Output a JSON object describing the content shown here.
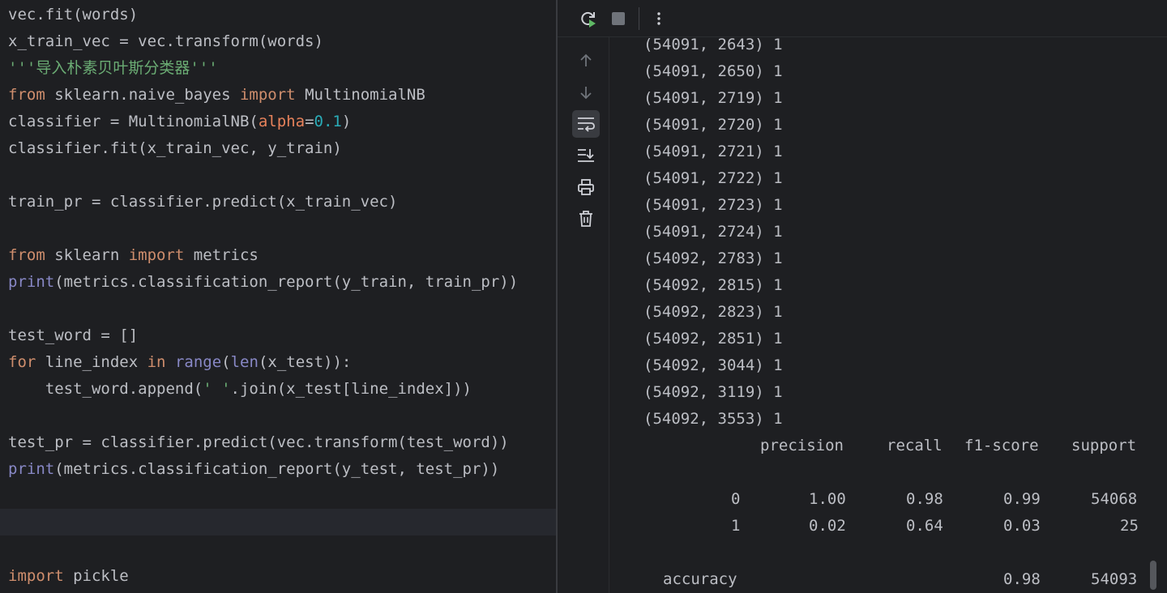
{
  "editor": {
    "lines": [
      [
        {
          "t": "vec.fit(words)",
          "c": ""
        }
      ],
      [
        {
          "t": "x_train_vec = vec.transform(words)",
          "c": ""
        }
      ],
      [
        {
          "t": "'''导入朴素贝叶斯分类器'''",
          "c": "cm"
        }
      ],
      [
        {
          "t": "from",
          "c": "kw"
        },
        {
          "t": " sklearn.naive_bayes ",
          "c": ""
        },
        {
          "t": "import",
          "c": "kw"
        },
        {
          "t": " MultinomialNB",
          "c": ""
        }
      ],
      [
        {
          "t": "classifier = MultinomialNB(",
          "c": ""
        },
        {
          "t": "alpha",
          "c": "pa"
        },
        {
          "t": "=",
          "c": ""
        },
        {
          "t": "0.1",
          "c": "nu"
        },
        {
          "t": ")",
          "c": ""
        }
      ],
      [
        {
          "t": "classifier.fit(x_train_vec, y_train)",
          "c": ""
        }
      ],
      [],
      [
        {
          "t": "train_pr = classifier.predict(x_train_vec)",
          "c": ""
        }
      ],
      [],
      [
        {
          "t": "from",
          "c": "kw"
        },
        {
          "t": " sklearn ",
          "c": ""
        },
        {
          "t": "import",
          "c": "kw"
        },
        {
          "t": " metrics",
          "c": ""
        }
      ],
      [
        {
          "t": "print",
          "c": "bi"
        },
        {
          "t": "(metrics.classification_report(y_train, train_pr))",
          "c": ""
        }
      ],
      [],
      [
        {
          "t": "test_word = []",
          "c": ""
        }
      ],
      [
        {
          "t": "for",
          "c": "kw"
        },
        {
          "t": " line_index ",
          "c": ""
        },
        {
          "t": "in",
          "c": "kw"
        },
        {
          "t": " ",
          "c": ""
        },
        {
          "t": "range",
          "c": "bi"
        },
        {
          "t": "(",
          "c": ""
        },
        {
          "t": "len",
          "c": "bi"
        },
        {
          "t": "(x_test)):",
          "c": ""
        }
      ],
      [
        {
          "t": "    test_word.append(",
          "c": ""
        },
        {
          "t": "' '",
          "c": "st"
        },
        {
          "t": ".join(x_test[line_index]))",
          "c": ""
        }
      ],
      [],
      [
        {
          "t": "test_pr = classifier.predict(vec.transform(test_word))",
          "c": ""
        }
      ],
      [
        {
          "t": "print",
          "c": "bi"
        },
        {
          "t": "(metrics.classification_report(y_test, test_pr))",
          "c": ""
        }
      ],
      [],
      [],
      [],
      [
        {
          "t": "import",
          "c": "kw"
        },
        {
          "t": " pickle",
          "c": ""
        }
      ]
    ]
  },
  "console": {
    "matrix_rows": [
      "(54091, 2643) 1",
      "(54091, 2650) 1",
      "(54091, 2719) 1",
      "(54091, 2720) 1",
      "(54091, 2721) 1",
      "(54091, 2722) 1",
      "(54091, 2723) 1",
      "(54091, 2724) 1",
      "(54092, 2783) 1",
      "(54092, 2815) 1",
      "(54092, 2823) 1",
      "(54092, 2851) 1",
      "(54092, 3044) 1",
      "(54092, 3119) 1",
      "(54092, 3553) 1"
    ],
    "report": {
      "headers": [
        "precision",
        "recall",
        "f1-score",
        "support"
      ],
      "rows": [
        {
          "label": "0",
          "precision": "1.00",
          "recall": "0.98",
          "f1": "0.99",
          "support": "54068"
        },
        {
          "label": "1",
          "precision": "0.02",
          "recall": "0.64",
          "f1": "0.03",
          "support": "25"
        }
      ],
      "accuracy": {
        "label": "accuracy",
        "f1": "0.98",
        "support": "54093"
      }
    }
  },
  "icons": {
    "rerun": "rerun-icon",
    "stop": "stop-icon",
    "more": "more-vertical-icon",
    "up": "arrow-up-icon",
    "down": "arrow-down-icon",
    "wrap": "soft-wrap-icon",
    "scroll_end": "scroll-to-end-icon",
    "print": "print-icon",
    "trash": "trash-icon"
  },
  "colors": {
    "background": "#1e1f22",
    "text": "#bcbec4",
    "keyword": "#cf8e6d",
    "builtin": "#8888c6",
    "string": "#6aab73",
    "number": "#2aacb8",
    "param": "#e7825b"
  }
}
